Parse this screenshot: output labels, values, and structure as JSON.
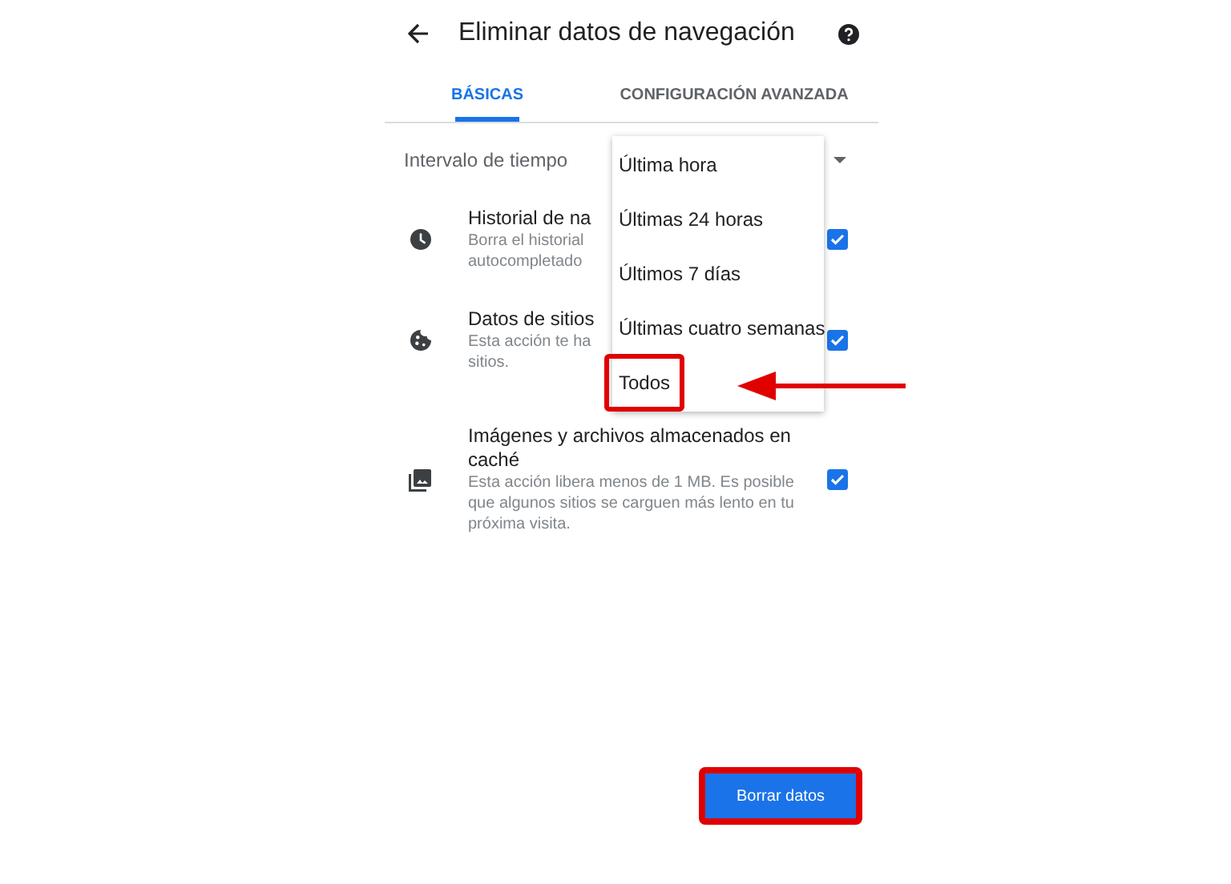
{
  "header": {
    "title": "Eliminar datos de navegación"
  },
  "tabs": [
    {
      "label": "BÁSICAS",
      "selected": true
    },
    {
      "label": "CONFIGURACIÓN AVANZADA",
      "selected": false
    }
  ],
  "interval": {
    "label": "Intervalo de tiempo"
  },
  "items": [
    {
      "kind": "clock",
      "title": "Historial de na",
      "lines": [
        "Borra el historial",
        "autocompletado"
      ],
      "checked": true
    },
    {
      "kind": "cookie",
      "title": "Datos de sitios",
      "lines": [
        "Esta acción te ha",
        "sitios."
      ],
      "checked": true
    },
    {
      "kind": "image",
      "title": "Imágenes y archivos almacenados en caché",
      "lines": [
        "Esta acción libera menos de 1 MB. Es posible que algunos sitios se carguen más lento en tu próxima visita."
      ],
      "checked": true
    }
  ],
  "dropdown": {
    "options": [
      {
        "label": "Última hora",
        "highlighted": false
      },
      {
        "label": "Últimas 24 horas",
        "highlighted": false
      },
      {
        "label": "Últimos 7 días",
        "highlighted": false
      },
      {
        "label": "Últimas cuatro semanas",
        "highlighted": false
      },
      {
        "label": "Todos",
        "highlighted": true
      }
    ]
  },
  "button": {
    "label": "Borrar datos",
    "highlighted": true
  }
}
